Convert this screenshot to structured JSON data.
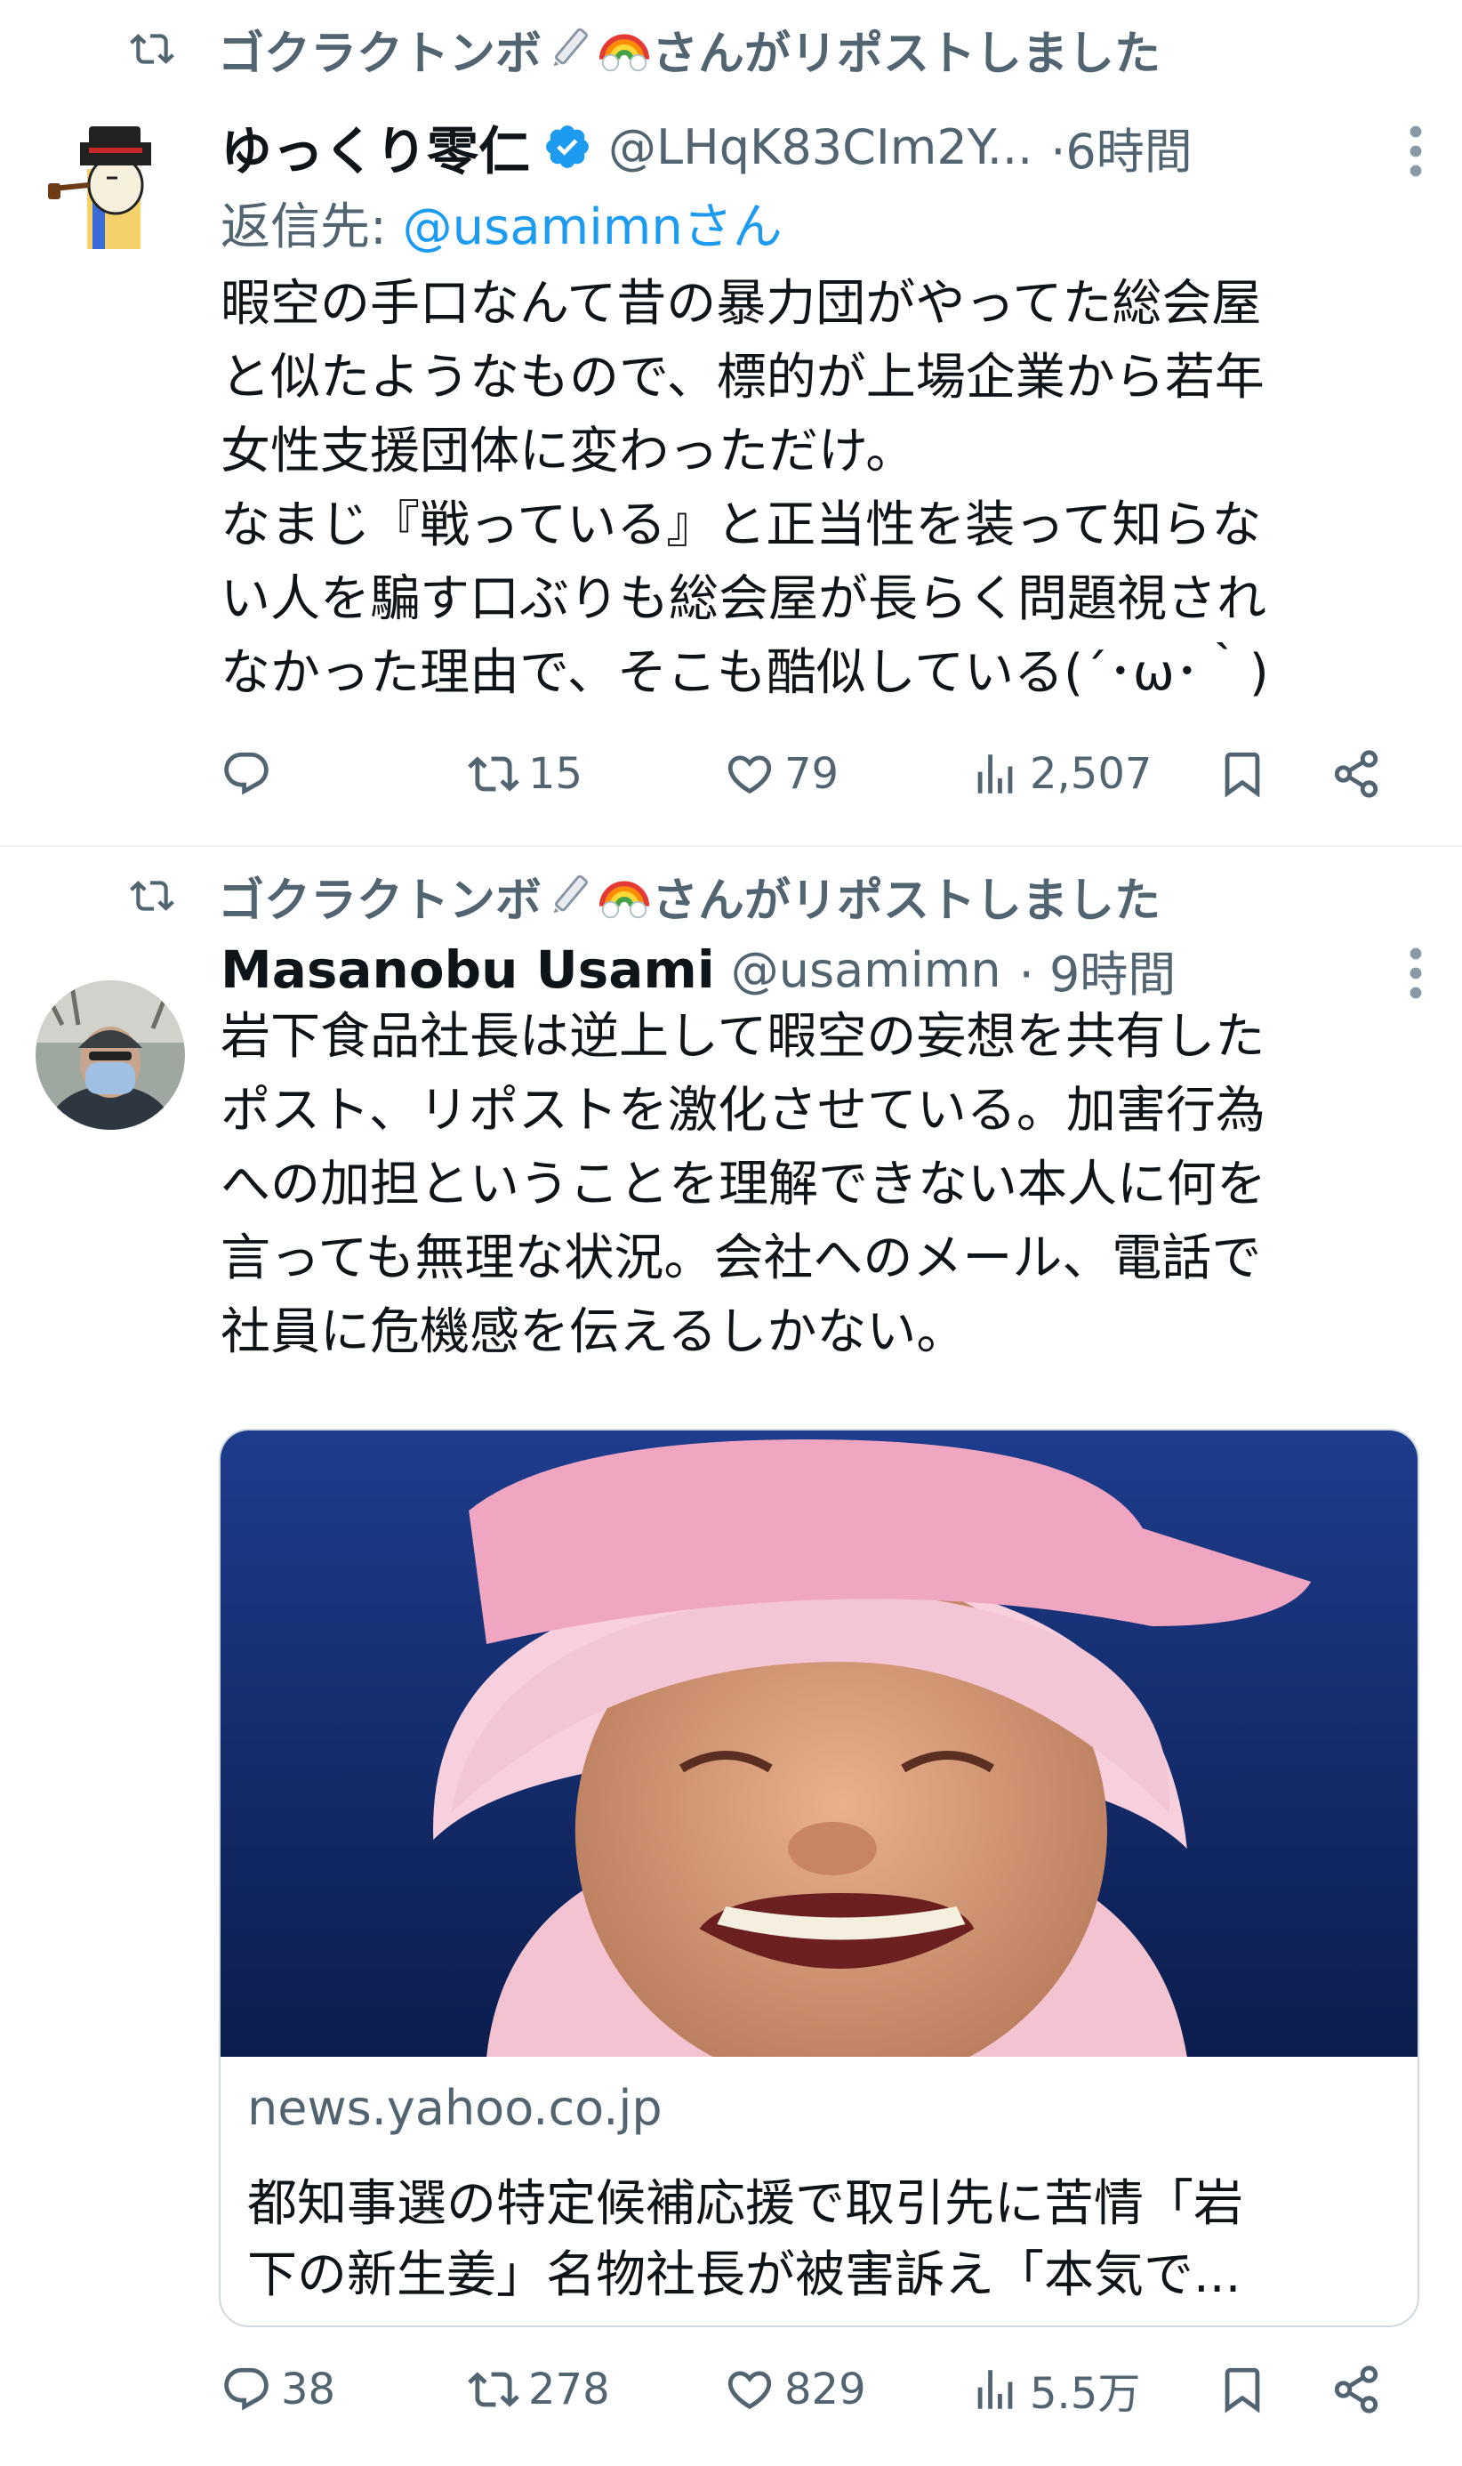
{
  "tweet1": {
    "repost_by": "ゴクラクトンボ",
    "repost_suffix": "さんがリポストしました",
    "name": "ゆっくり零仁",
    "handle": "@LHqK83CIm2Y...",
    "time": "·6時間",
    "reply_prefix": "返信先: ",
    "reply_mention": "@usamimnさん",
    "body": "暇空の手口なんて昔の暴力団がやってた総会屋\nと似たようなもので、標的が上場企業から若年\n女性支援団体に変わっただけ。\nなまじ『戦っている』と正当性を装って知らな\nい人を騙す口ぶりも総会屋が長らく問題視され\nなかった理由で、そこも酷似している(´･ω･｀)",
    "stats": {
      "replies": "",
      "reposts": "15",
      "likes": "79",
      "views": "2,507"
    }
  },
  "tweet2": {
    "repost_by": "ゴクラクトンボ",
    "repost_suffix": "さんがリポストしました",
    "name": "Masanobu Usami",
    "handle": "@usamimn",
    "time": "· 9時間",
    "body": "岩下食品社長は逆上して暇空の妄想を共有した\nポスト、リポストを激化させている。加害行為\nへの加担ということを理解できない本人に何を\n言っても無理な状況。会社へのメール、電話で\n社員に危機感を伝えるしかない。",
    "card": {
      "domain": "news.yahoo.co.jp",
      "title": "都知事選の特定候補応援で取引先に苦情「岩\n下の新生姜」名物社長が被害訴え「本気で..."
    },
    "stats": {
      "replies": "38",
      "reposts": "278",
      "likes": "829",
      "views": "5.5万"
    }
  },
  "colors": {
    "text": "#0f1419",
    "secondary": "#536471",
    "link": "#1d9bf0",
    "verified": "#1d9bf0",
    "divider": "#eff3f4"
  },
  "icons": {
    "repost": "repost-icon",
    "reply": "reply-icon",
    "like": "heart-icon",
    "views": "views-icon",
    "bookmark": "bookmark-icon",
    "share": "share-icon",
    "more": "more-icon",
    "verified": "verified-badge-icon",
    "pencil": "pencil-emoji-icon",
    "rainbow": "rainbow-emoji-icon"
  }
}
